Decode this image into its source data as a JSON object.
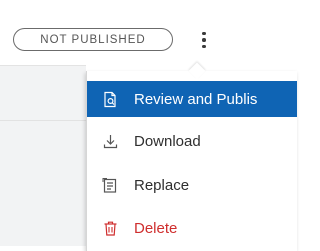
{
  "status": {
    "label": "NOT PUBLISHED"
  },
  "more_menu": {
    "icon": "vertical-ellipsis-icon"
  },
  "menu": {
    "items": [
      {
        "label": "Review and Publis",
        "icon": "review-document-icon",
        "state": "highlighted"
      },
      {
        "label": "Download",
        "icon": "download-arrow-icon"
      },
      {
        "label": "Replace",
        "icon": "replace-file-icon"
      },
      {
        "label": "Delete",
        "icon": "trash-icon",
        "style": "destructive"
      }
    ]
  },
  "colors": {
    "highlight": "#0f64b4",
    "destructive": "#cf2e2e",
    "text": "#2f2f2f"
  }
}
